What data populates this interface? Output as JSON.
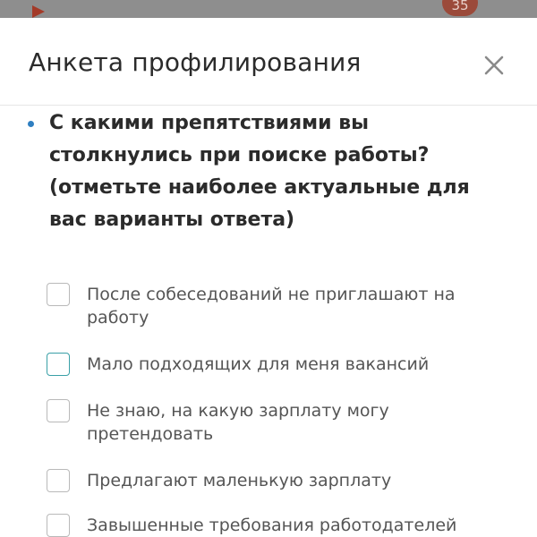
{
  "background": {
    "badge_count": "35"
  },
  "modal": {
    "title": "Анкета профилирования",
    "close_icon": "close-icon"
  },
  "question": {
    "lines": [
      "С какими препятствиями вы",
      "столкнулись при поиске работы?",
      "(отметьте наиболее актуальные для",
      "вас варианты ответа)"
    ]
  },
  "options": [
    {
      "lines": [
        "После собеседований не приглашают на",
        "работу"
      ],
      "checked": false
    },
    {
      "lines": [
        "Мало подходящих для меня вакансий"
      ],
      "checked": false,
      "focused": true
    },
    {
      "lines": [
        "Не знаю, на какую зарплату могу",
        "претендовать"
      ],
      "checked": false
    },
    {
      "lines": [
        "Предлагают маленькую зарплату"
      ],
      "checked": false
    },
    {
      "lines": [
        "Завышенные требования работодателей"
      ],
      "checked": false
    }
  ],
  "colors": {
    "accent": "#2f7fc1",
    "focus": "#3aa0a7",
    "text_primary": "#2b2b2b",
    "text_secondary": "#555555"
  }
}
